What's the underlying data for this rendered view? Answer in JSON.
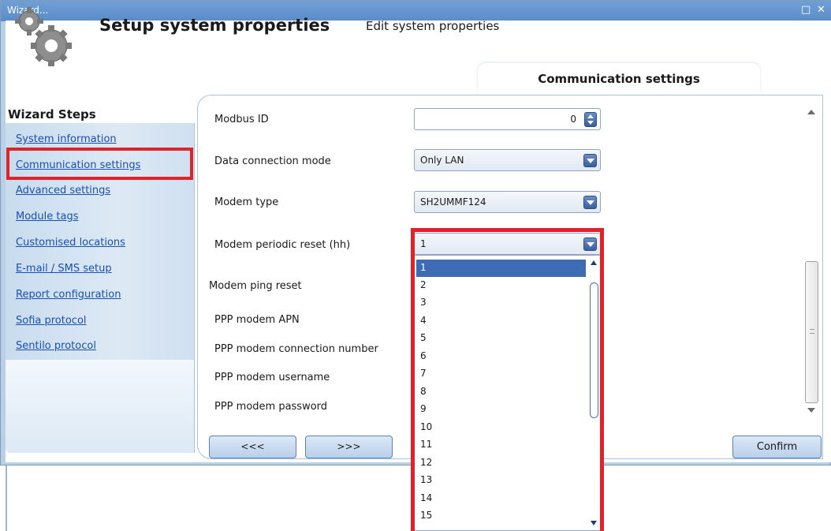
{
  "window": {
    "title": "Wizard..."
  },
  "header": {
    "title": "Setup system properties",
    "subtitle": "Edit system properties",
    "tab_label": "Communication settings"
  },
  "wizard": {
    "title": "Wizard Steps",
    "steps": [
      "System information",
      "Communication settings",
      "Advanced settings",
      "Module tags",
      "Customised locations",
      "E-mail / SMS setup",
      "Report configuration",
      "Sofia protocol",
      "Sentilo protocol"
    ],
    "selected_step": "Communication settings"
  },
  "form": {
    "modbus_id": {
      "label": "Modbus ID",
      "value": "0"
    },
    "data_connection_mode": {
      "label": "Data connection mode",
      "value": "Only LAN"
    },
    "modem_type": {
      "label": "Modem type",
      "value": "SH2UMMF124"
    },
    "modem_periodic_reset": {
      "label": "Modem periodic reset (hh)",
      "value": "1"
    },
    "modem_ping_reset": {
      "label": "Modem ping reset"
    },
    "ppp_apn": {
      "label": "PPP modem APN"
    },
    "ppp_connection_number": {
      "label": "PPP modem connection number"
    },
    "ppp_username": {
      "label": "PPP modem username"
    },
    "ppp_password": {
      "label": "PPP modem password"
    }
  },
  "dropdown": {
    "options": [
      "1",
      "2",
      "3",
      "4",
      "5",
      "6",
      "7",
      "8",
      "9",
      "10",
      "11",
      "12",
      "13",
      "14",
      "15"
    ],
    "selected": "1"
  },
  "buttons": {
    "back": "<<<",
    "next": ">>>",
    "confirm": "Confirm"
  },
  "colors": {
    "highlight": "#e0222a",
    "accent": "#3d6bb4",
    "titlebar": "#5a8cc8"
  }
}
